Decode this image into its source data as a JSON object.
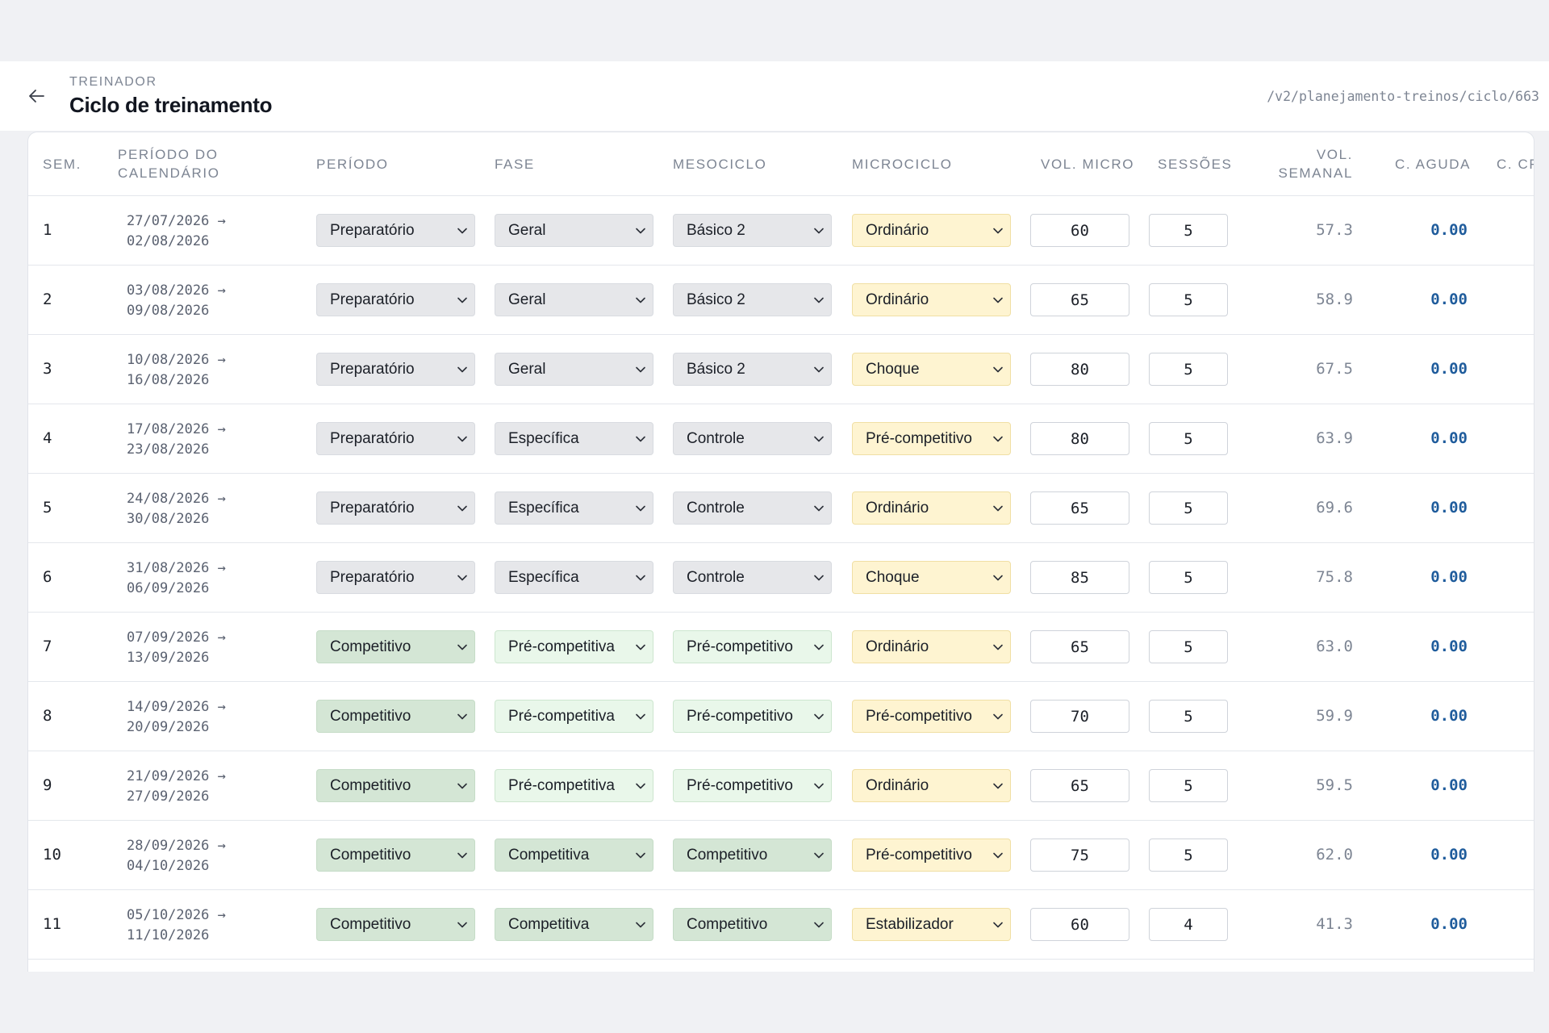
{
  "header": {
    "overline": "TREINADOR",
    "title": "Ciclo de treinamento",
    "route": "/v2/planejamento-treinos/ciclo/663",
    "back_icon": "arrow-left-icon"
  },
  "columns": {
    "sem": "SEM.",
    "calendar_1": "PERÍODO DO",
    "calendar_2": "CALENDÁRIO",
    "period": "PERÍODO",
    "phase": "FASE",
    "mesocycle": "MESOCICLO",
    "microcycle": "MICROCICLO",
    "vol_micro": "VOL. MICRO",
    "sessions": "SESSÕES",
    "weekly_1": "VOL.",
    "weekly_2": "SEMANAL",
    "acute": "C. AGUDA",
    "chronic": "C. CR"
  },
  "colors": {
    "gray_select": "#e6e7ea",
    "green_select": "#d4e6d5",
    "light_green_select": "#e9f7ea",
    "yellow_select": "#fef4d1",
    "acute_value": "#1f5c9c"
  },
  "rows": [
    {
      "sem": "1",
      "start": "27/07/2026 →",
      "end": "02/08/2026",
      "period": "Preparatório",
      "phase": "Geral",
      "mesocycle": "Básico 2",
      "microcycle": "Ordinário",
      "vol_micro": "60",
      "sessions": "5",
      "weekly": "57.3",
      "acute": "0.00"
    },
    {
      "sem": "2",
      "start": "03/08/2026 →",
      "end": "09/08/2026",
      "period": "Preparatório",
      "phase": "Geral",
      "mesocycle": "Básico 2",
      "microcycle": "Ordinário",
      "vol_micro": "65",
      "sessions": "5",
      "weekly": "58.9",
      "acute": "0.00"
    },
    {
      "sem": "3",
      "start": "10/08/2026 →",
      "end": "16/08/2026",
      "period": "Preparatório",
      "phase": "Geral",
      "mesocycle": "Básico 2",
      "microcycle": "Choque",
      "vol_micro": "80",
      "sessions": "5",
      "weekly": "67.5",
      "acute": "0.00"
    },
    {
      "sem": "4",
      "start": "17/08/2026 →",
      "end": "23/08/2026",
      "period": "Preparatório",
      "phase": "Específica",
      "mesocycle": "Controle",
      "microcycle": "Pré-competitivo",
      "vol_micro": "80",
      "sessions": "5",
      "weekly": "63.9",
      "acute": "0.00"
    },
    {
      "sem": "5",
      "start": "24/08/2026 →",
      "end": "30/08/2026",
      "period": "Preparatório",
      "phase": "Específica",
      "mesocycle": "Controle",
      "microcycle": "Ordinário",
      "vol_micro": "65",
      "sessions": "5",
      "weekly": "69.6",
      "acute": "0.00"
    },
    {
      "sem": "6",
      "start": "31/08/2026 →",
      "end": "06/09/2026",
      "period": "Preparatório",
      "phase": "Específica",
      "mesocycle": "Controle",
      "microcycle": "Choque",
      "vol_micro": "85",
      "sessions": "5",
      "weekly": "75.8",
      "acute": "0.00"
    },
    {
      "sem": "7",
      "start": "07/09/2026 →",
      "end": "13/09/2026",
      "period": "Competitivo",
      "phase": "Pré-competitiva",
      "mesocycle": "Pré-competitivo",
      "microcycle": "Ordinário",
      "vol_micro": "65",
      "sessions": "5",
      "weekly": "63.0",
      "acute": "0.00"
    },
    {
      "sem": "8",
      "start": "14/09/2026 →",
      "end": "20/09/2026",
      "period": "Competitivo",
      "phase": "Pré-competitiva",
      "mesocycle": "Pré-competitivo",
      "microcycle": "Pré-competitivo",
      "vol_micro": "70",
      "sessions": "5",
      "weekly": "59.9",
      "acute": "0.00"
    },
    {
      "sem": "9",
      "start": "21/09/2026 →",
      "end": "27/09/2026",
      "period": "Competitivo",
      "phase": "Pré-competitiva",
      "mesocycle": "Pré-competitivo",
      "microcycle": "Ordinário",
      "vol_micro": "65",
      "sessions": "5",
      "weekly": "59.5",
      "acute": "0.00"
    },
    {
      "sem": "10",
      "start": "28/09/2026 →",
      "end": "04/10/2026",
      "period": "Competitivo",
      "phase": "Competitiva",
      "mesocycle": "Competitivo",
      "microcycle": "Pré-competitivo",
      "vol_micro": "75",
      "sessions": "5",
      "weekly": "62.0",
      "acute": "0.00"
    },
    {
      "sem": "11",
      "start": "05/10/2026 →",
      "end": "11/10/2026",
      "period": "Competitivo",
      "phase": "Competitiva",
      "mesocycle": "Competitivo",
      "microcycle": "Estabilizador",
      "vol_micro": "60",
      "sessions": "4",
      "weekly": "41.3",
      "acute": "0.00"
    }
  ]
}
